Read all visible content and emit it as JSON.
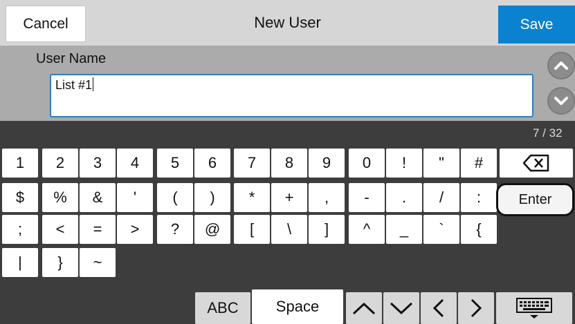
{
  "header": {
    "cancel_label": "Cancel",
    "title": "New User",
    "save_label": "Save"
  },
  "field": {
    "label": "User Name",
    "value": "List #1"
  },
  "counter": "7 / 32",
  "keyboard": {
    "row1": [
      "1",
      "2",
      "3",
      "4",
      "5",
      "6",
      "7",
      "8",
      "9",
      "0",
      "!",
      "\"",
      "#"
    ],
    "row2": [
      "$",
      "%",
      "&",
      "'",
      "(",
      ")",
      "*",
      "+",
      ",",
      "-",
      ".",
      "/",
      ":"
    ],
    "row3": [
      ";",
      "<",
      "=",
      ">",
      "?",
      "@",
      "[",
      "\\",
      "]",
      "^",
      "_",
      "`",
      "{"
    ],
    "row4": [
      "|",
      "}",
      "~"
    ],
    "enter_label": "Enter",
    "abc_label": "ABC",
    "space_label": "Space"
  },
  "colors": {
    "accent": "#0b82d0",
    "header_bg": "#d6d6d6",
    "field_area_bg": "#ababab",
    "keyboard_bg": "#3d3d3d"
  },
  "icons": {
    "scroll_up": "chevron-up-circle-icon",
    "scroll_down": "chevron-down-circle-icon",
    "backspace": "backspace-icon",
    "cursor_up": "chevron-up-icon",
    "cursor_down": "chevron-down-icon",
    "cursor_left": "chevron-left-icon",
    "cursor_right": "chevron-right-icon",
    "keyboard": "keyboard-icon"
  }
}
